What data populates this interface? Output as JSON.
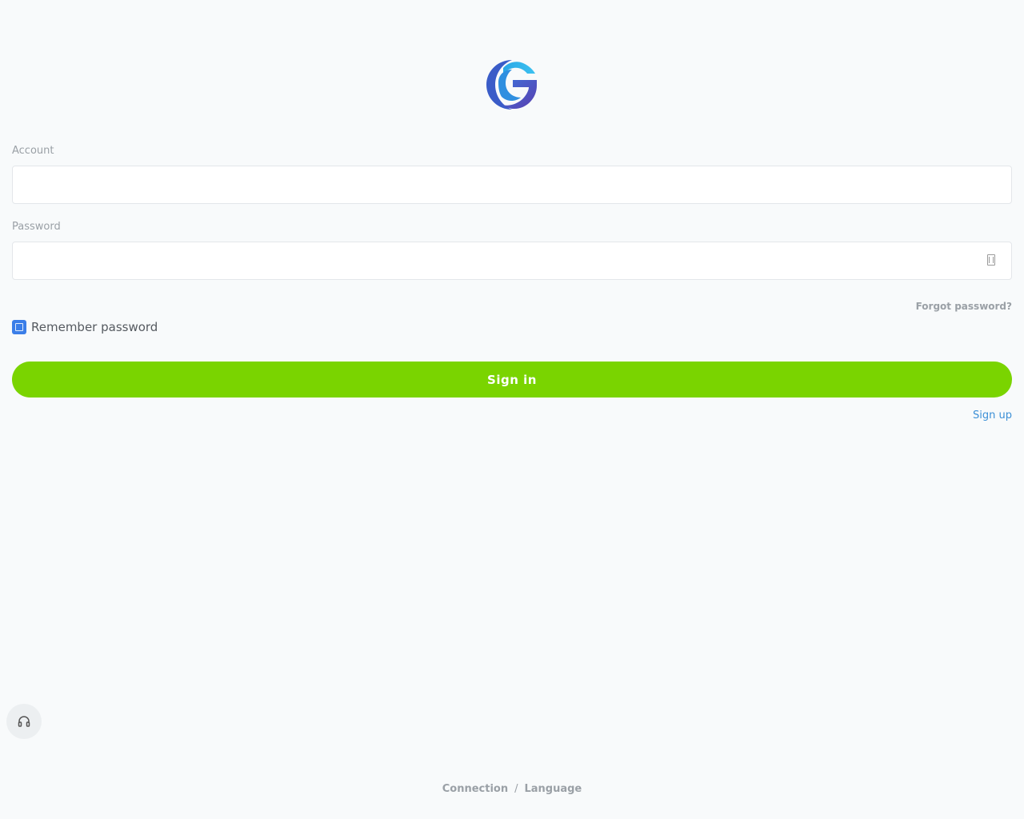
{
  "logo": {
    "icon": "brand-g-logo-icon",
    "colors": {
      "top": "#35b4ea",
      "bottom": "#5a3fb0",
      "mid": "#3f6fd8"
    }
  },
  "form": {
    "account_label": "Account",
    "account_value": "",
    "account_placeholder": "",
    "password_label": "Password",
    "password_value": "",
    "password_placeholder": "",
    "password_toggle_icon": "eye-toggle-icon",
    "forgot_label": "Forgot password?",
    "remember_label": "Remember password",
    "remember_checked": true,
    "signin_label": "Sign in",
    "signup_label": "Sign up"
  },
  "support": {
    "icon": "headset-icon"
  },
  "footer": {
    "connection_label": "Connection",
    "separator": "/",
    "language_label": "Language"
  },
  "colors": {
    "background": "#f8fafb",
    "primary_button": "#7ad400",
    "link": "#3b8fd6",
    "checkbox": "#3b7ee8",
    "muted_text": "#9aa0a6"
  }
}
